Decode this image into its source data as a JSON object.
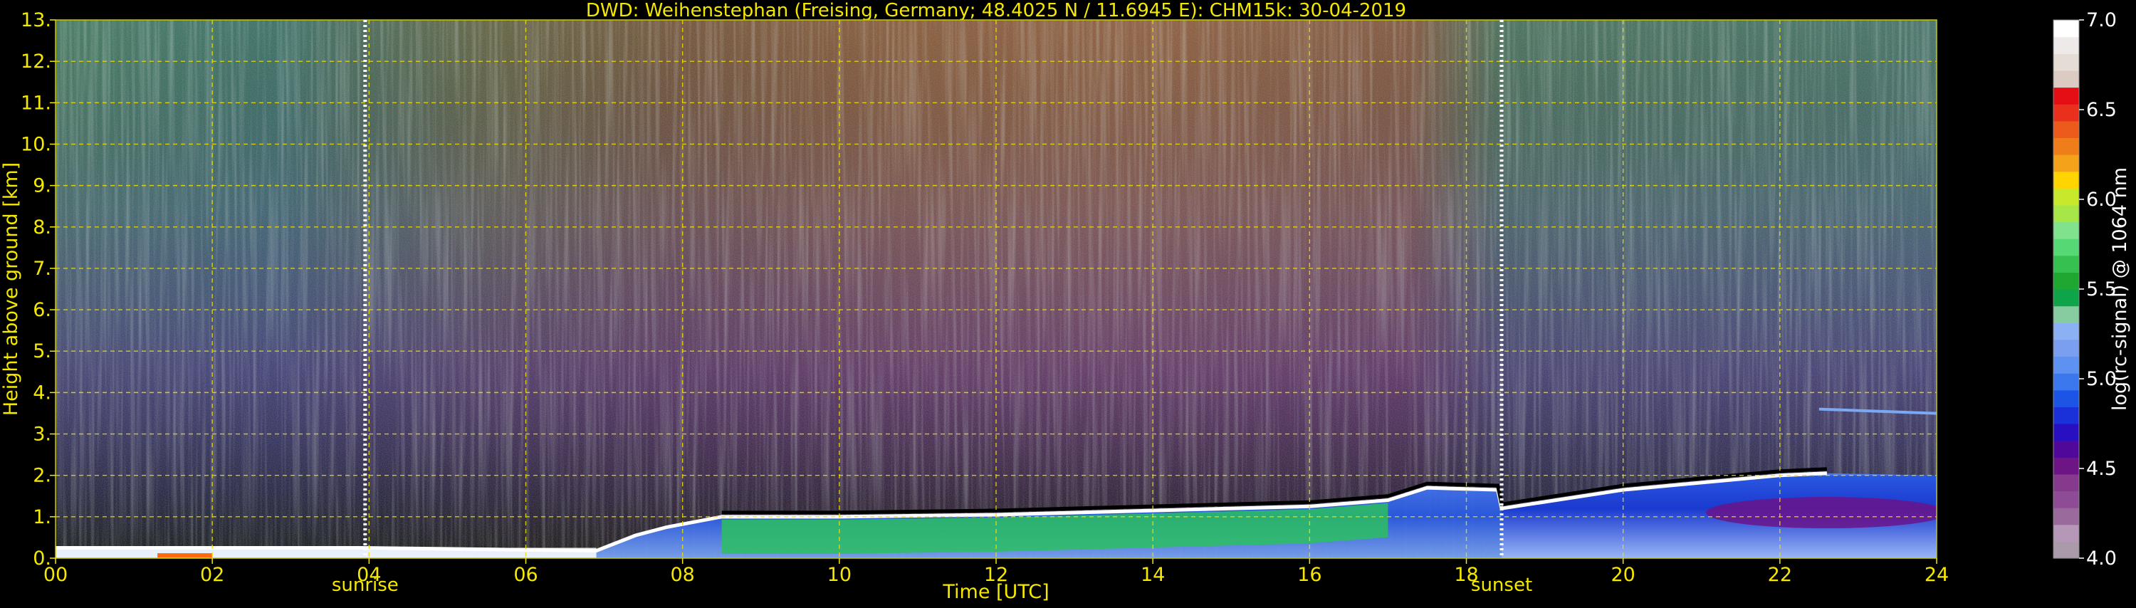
{
  "chart_data": {
    "type": "heatmap",
    "title": "DWD: Weihenstephan (Freising, Germany; 48.4025 N / 11.6945 E):    CHM15k: 30-04-2019",
    "xlabel": "Time [UTC]",
    "ylabel": "Height above ground [km]",
    "xlim": [
      0,
      24
    ],
    "ylim": [
      0,
      13
    ],
    "x_ticks": [
      "00",
      "02",
      "04",
      "06",
      "08",
      "10",
      "12",
      "14",
      "16",
      "18",
      "20",
      "22",
      "24"
    ],
    "y_ticks": [
      "0.",
      "1.",
      "2.",
      "3.",
      "4.",
      "5.",
      "6.",
      "7.",
      "8.",
      "9.",
      "10.",
      "11.",
      "12.",
      "13."
    ],
    "grid": true,
    "annotations": [
      {
        "label": "sunrise",
        "x": 3.95
      },
      {
        "label": "sunset",
        "x": 18.45
      }
    ],
    "colorbar": {
      "label": "log(rc-signal) @ 1064 nm",
      "range": [
        4.0,
        7.0
      ],
      "ticks": [
        "4.0",
        "4.5",
        "5.0",
        "5.5",
        "6.0",
        "6.5",
        "7.0"
      ],
      "colors": [
        "#aa9aaa",
        "#b598b7",
        "#9a6a9c",
        "#8e4c96",
        "#853a8e",
        "#6e1585",
        "#50089a",
        "#2810c0",
        "#1a30d8",
        "#1c55e6",
        "#3b78ee",
        "#5d92f2",
        "#7a9ef0",
        "#8cb0f4",
        "#87cca0",
        "#0da44a",
        "#1ea832",
        "#36c050",
        "#56d874",
        "#80e28c",
        "#a6e646",
        "#c8e82c",
        "#ffd400",
        "#f4a21a",
        "#ef7e1a",
        "#ec5a1c",
        "#e8301c",
        "#e50e14",
        "#dccbc2",
        "#e6dcd6",
        "#eeeaea",
        "#ffffff"
      ]
    },
    "features": {
      "boundary_layer_top_km": [
        [
          0.0,
          0.25
        ],
        [
          3.9,
          0.25
        ],
        [
          6.9,
          0.18
        ],
        [
          7.4,
          0.55
        ],
        [
          7.8,
          0.75
        ],
        [
          8.5,
          1.0
        ],
        [
          10.0,
          1.0
        ],
        [
          12.0,
          1.05
        ],
        [
          14.0,
          1.15
        ],
        [
          16.0,
          1.25
        ],
        [
          17.0,
          1.4
        ],
        [
          17.5,
          1.7
        ],
        [
          18.4,
          1.65
        ],
        [
          18.45,
          1.2
        ],
        [
          20.0,
          1.65
        ],
        [
          22.0,
          2.0
        ],
        [
          22.6,
          2.05
        ]
      ],
      "elevated_layer": {
        "x": [
          22.5,
          24.0
        ],
        "height_km": 3.6
      },
      "bright_curtain_span": [
        7.9,
        17.0
      ]
    }
  }
}
